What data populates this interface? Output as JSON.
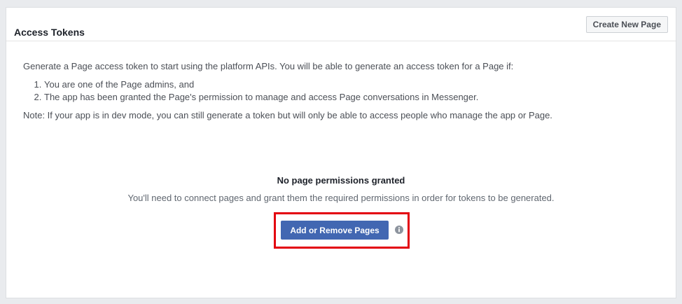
{
  "panel": {
    "title": "Access Tokens",
    "create_button_label": "Create New Page"
  },
  "intro": {
    "text": "Generate a Page access token to start using the platform APIs. You will be able to generate an access token for a Page if:",
    "conditions": [
      "You are one of the Page admins, and",
      "The app has been granted the Page's permission to manage and access Page conversations in Messenger."
    ],
    "note": "Note: If your app is in dev mode, you can still generate a token but will only be able to access people who manage the app or Page."
  },
  "empty_state": {
    "title": "No page permissions granted",
    "description": "You'll need to connect pages and grant them the required permissions in order for tokens to be generated.",
    "button_label": "Add or Remove Pages",
    "info_icon": "info-icon"
  },
  "colors": {
    "primary_button": "#4267b2",
    "highlight": "#e3000f",
    "panel_border": "#dddfe2"
  }
}
